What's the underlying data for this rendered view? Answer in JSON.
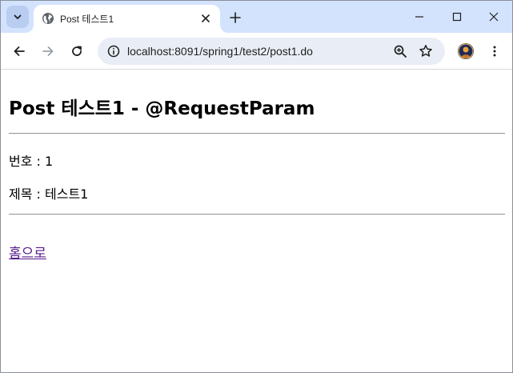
{
  "browser": {
    "tab": {
      "title": "Post 테스트1"
    },
    "address_bar": {
      "url": "localhost:8091/spring1/test2/post1.do"
    }
  },
  "page": {
    "heading": "Post 테스트1 - @RequestParam",
    "number_line": "번호 : 1",
    "title_line": "제목 : 테스트1",
    "home_link": "홈으로"
  },
  "icons": {
    "tab_search": "chevron-down-icon",
    "favicon": "globe-icon",
    "tab_close": "close-icon",
    "new_tab": "plus-icon",
    "minimize": "minimize-icon",
    "maximize": "maximize-icon",
    "window_close": "close-icon",
    "back": "arrow-left-icon",
    "forward": "arrow-right-icon",
    "reload": "reload-icon",
    "site_info": "info-icon",
    "zoom": "zoom-icon",
    "bookmark": "star-icon",
    "profile": "avatar",
    "menu": "kebab-menu-icon"
  },
  "colors": {
    "tabstrip": "#d3e3fd",
    "omnibox": "#e9eef6",
    "visited_link": "#551a8b"
  }
}
